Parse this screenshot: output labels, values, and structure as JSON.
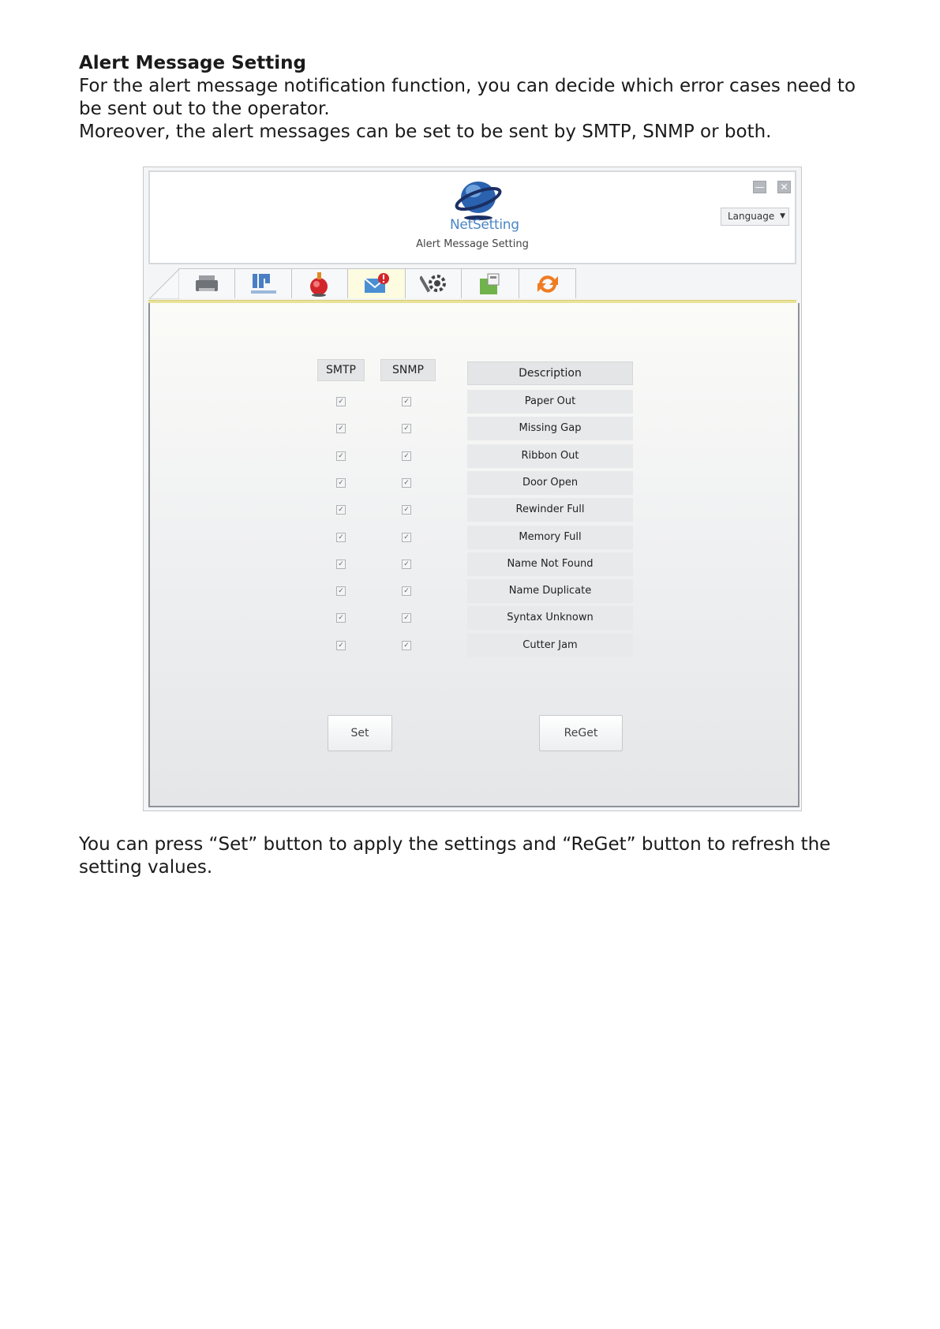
{
  "intro": {
    "heading": "Alert Message Setting",
    "line1": "For the alert message notification function, you can decide which error cases need to be sent out to the operator.",
    "line2": "Moreover, the alert messages can be set to be sent by SMTP, SNMP or both."
  },
  "window": {
    "brand": "NetSetting",
    "title": "Alert Message Setting",
    "language_label": "Language",
    "tabs": [
      {
        "name": "printer-icon",
        "active": false
      },
      {
        "name": "network-icon",
        "active": false
      },
      {
        "name": "tools-icon",
        "active": false
      },
      {
        "name": "alert-message-icon",
        "active": true
      },
      {
        "name": "service-icon",
        "active": false
      },
      {
        "name": "key-icon",
        "active": false
      },
      {
        "name": "update-icon",
        "active": false
      }
    ],
    "columns": {
      "smtp": "SMTP",
      "snmp": "SNMP",
      "description": "Description"
    },
    "rows": [
      {
        "description": "Paper Out",
        "smtp": true,
        "snmp": true
      },
      {
        "description": "Missing Gap",
        "smtp": true,
        "snmp": true
      },
      {
        "description": "Ribbon Out",
        "smtp": true,
        "snmp": true
      },
      {
        "description": "Door Open",
        "smtp": true,
        "snmp": true
      },
      {
        "description": "Rewinder Full",
        "smtp": true,
        "snmp": true
      },
      {
        "description": "Memory Full",
        "smtp": true,
        "snmp": true
      },
      {
        "description": "Name Not Found",
        "smtp": true,
        "snmp": true
      },
      {
        "description": "Name Duplicate",
        "smtp": true,
        "snmp": true
      },
      {
        "description": "Syntax Unknown",
        "smtp": true,
        "snmp": true
      },
      {
        "description": "Cutter Jam",
        "smtp": true,
        "snmp": true
      }
    ],
    "set_label": "Set",
    "reget_label": "ReGet"
  },
  "outro": {
    "text": "You can press “Set” button to apply the settings and “ReGet” button to refresh the setting values."
  },
  "colors": {
    "brand": "#4a86c5",
    "tab_active": "#fdfbe0",
    "tab_underline": "#e9e29a"
  }
}
